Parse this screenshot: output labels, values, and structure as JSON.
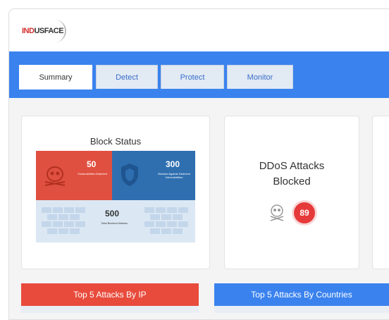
{
  "brand": {
    "logo_text_red": "IND",
    "logo_text_dark": "USFACE"
  },
  "tabs": [
    {
      "label": "Summary",
      "active": true
    },
    {
      "label": "Detect",
      "active": false
    },
    {
      "label": "Protect",
      "active": false
    },
    {
      "label": "Monitor",
      "active": false
    }
  ],
  "block_status": {
    "title": "Block Status",
    "vulnerabilities": {
      "value": "50",
      "label": "Vulnerabilities Detected"
    },
    "blocked": {
      "value": "300",
      "label": "Blocked Against Detected Vulnerabilities"
    },
    "total": {
      "value": "500",
      "label": "Total Blocked Attacks"
    }
  },
  "ddos": {
    "title_line1": "DDoS Attacks",
    "title_line2": "Blocked",
    "count": "89"
  },
  "panels": {
    "by_ip": "Top 5 Attacks By IP",
    "by_countries": "Top 5 Attacks By Countries"
  },
  "colors": {
    "accent_blue": "#3a82ee",
    "red": "#e05040",
    "steel_blue": "#2f6fb0",
    "light_blue": "#dbe8f4"
  }
}
